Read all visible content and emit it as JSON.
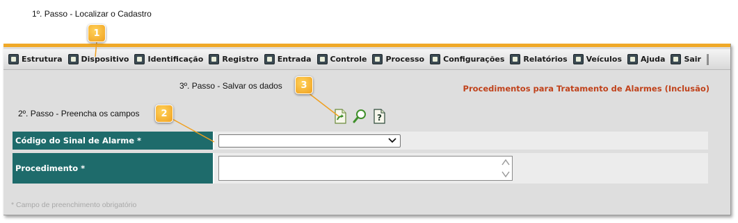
{
  "steps": {
    "step1": "1º. Passo - Localizar o Cadastro",
    "step2": "2º. Passo - Preencha os campos",
    "step3": "3º. Passo - Salvar os dados"
  },
  "markers": [
    "1",
    "2",
    "3"
  ],
  "menu": {
    "items": [
      {
        "label": "Estrutura",
        "icon": "building-icon"
      },
      {
        "label": "Dispositivo",
        "icon": "device-icon"
      },
      {
        "label": "Identificação",
        "icon": "users-icon"
      },
      {
        "label": "Registro",
        "icon": "register-icon"
      },
      {
        "label": "Entrada",
        "icon": "entry-icon"
      },
      {
        "label": "Controle",
        "icon": "user-control-icon"
      },
      {
        "label": "Processo",
        "icon": "tools-icon"
      },
      {
        "label": "Configurações",
        "icon": "layers-icon"
      },
      {
        "label": "Relatórios",
        "icon": "report-icon"
      },
      {
        "label": "Veículos",
        "icon": "car-icon"
      },
      {
        "label": "Ajuda",
        "icon": "help-icon"
      },
      {
        "label": "Sair",
        "icon": "exit-icon"
      }
    ]
  },
  "page": {
    "title": "Procedimentos para Tratamento de Alarmes (Inclusão)"
  },
  "toolbar": {
    "save_icon": "save-document-icon",
    "search_icon": "search-icon",
    "help_icon": "help-document-icon"
  },
  "form": {
    "signal_code_label": "Código do Sinal de Alarme *",
    "signal_code_value": "",
    "procedure_label": "Procedimento *",
    "procedure_value": ""
  },
  "required_note": "* Campo de preenchimento obrigatório",
  "colors": {
    "accent_orange": "#f0a928",
    "label_teal": "#1e6b6b",
    "title_red": "#c0421b"
  }
}
